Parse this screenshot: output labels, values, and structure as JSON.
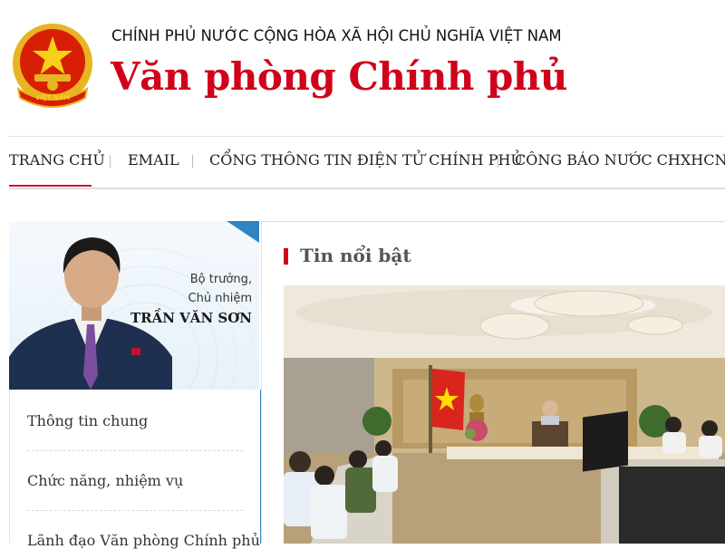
{
  "header": {
    "government_name": "CHÍNH PHỦ NƯỚC CỘNG HÒA XÃ HỘI CHỦ NGHĨA VIỆT NAM",
    "office_name": "Văn phòng Chính phủ",
    "emblem_icon": "national-emblem-icon",
    "emblem_banner_text": "VIỆT NAM"
  },
  "nav": {
    "items": [
      {
        "label": "TRANG CHỦ",
        "active": true
      },
      {
        "label": "EMAIL",
        "active": false
      },
      {
        "label": "CỔNG THÔNG TIN ĐIỆN TỬ CHÍNH PHỦ",
        "active": false
      },
      {
        "label": "CÔNG BÁO NƯỚC CHXHCNVN",
        "active": false
      }
    ]
  },
  "minister": {
    "role_line1": "Bộ trưởng,",
    "role_line2": "Chủ nhiệm",
    "name": "TRẦN VĂN SƠN"
  },
  "left_menu": {
    "items": [
      {
        "label": "Thông tin chung"
      },
      {
        "label": "Chức năng, nhiệm vụ"
      },
      {
        "label": "Lãnh đạo Văn phòng Chính phủ"
      }
    ]
  },
  "featured": {
    "title": "Tin nổi bật"
  },
  "colors": {
    "brand_red": "#d0021b",
    "accent_blue": "#2e86c1",
    "nav_active": "#c8102e"
  }
}
